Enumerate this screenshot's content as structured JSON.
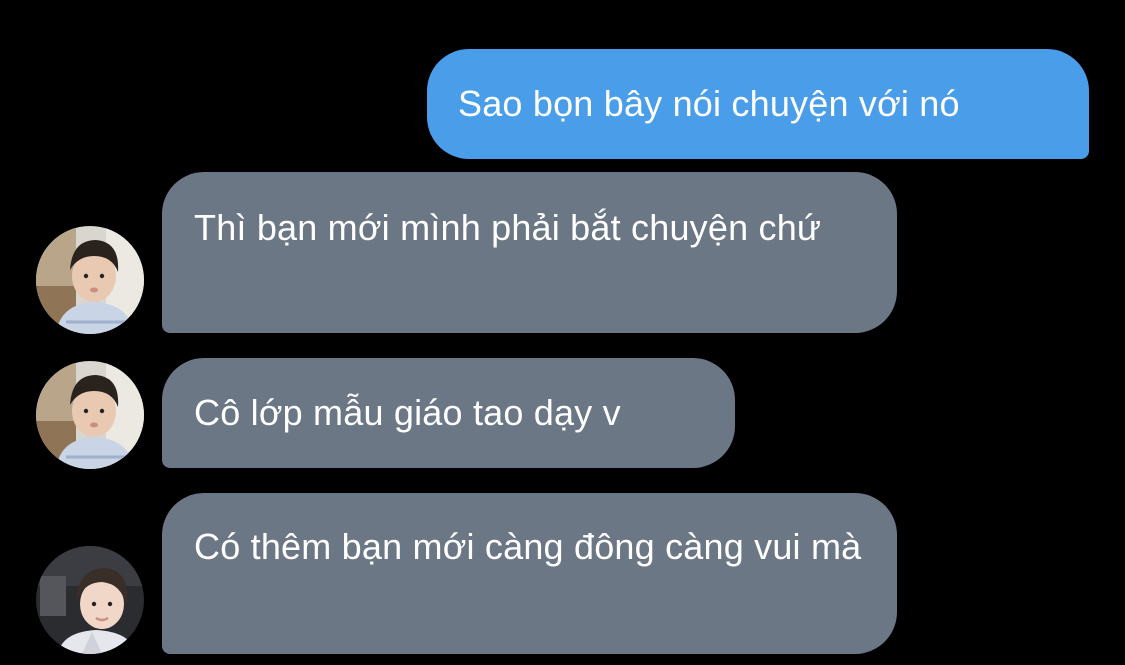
{
  "conversation": {
    "messages": [
      {
        "direction": "sent",
        "text": "Sao bọn bây nói chuyện với nó"
      },
      {
        "direction": "received",
        "text": "Thì bạn mới mình phải bắt chuyện chứ"
      },
      {
        "direction": "received",
        "text": "Cô lớp mẫu giáo tao dạy v"
      },
      {
        "direction": "received",
        "text": "Có thêm bạn mới càng đông càng vui mà"
      }
    ]
  },
  "colors": {
    "background": "#000000",
    "sent_bubble": "#4a9ee9",
    "received_bubble": "#6b7785",
    "text": "#ffffff"
  }
}
